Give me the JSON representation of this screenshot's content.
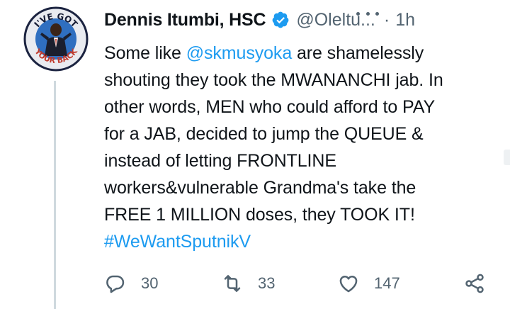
{
  "author": {
    "display_name": "Dennis Itumbi, HSC",
    "handle": "@Oleltu...",
    "time": "1h",
    "verified": true,
    "avatar_text_top": "I'VE GOT",
    "avatar_text_bottom": "YOUR BACK"
  },
  "header": {
    "separator": "·"
  },
  "tweet": {
    "lines": [
      [
        {
          "text": "Some like "
        },
        {
          "text": "@skmusyoka",
          "link": true
        },
        {
          "text": " are shamelessly"
        }
      ],
      [
        {
          "text": "shouting they took the MWANANCHI jab. In"
        }
      ],
      [
        {
          "text": "other words, MEN who could afford to PAY"
        }
      ],
      [
        {
          "text": "for a JAB, decided to jump the QUEUE &"
        }
      ],
      [
        {
          "text": "instead of letting FRONTLINE"
        }
      ],
      [
        {
          "text": "workers&vulnerable Grandma's take the"
        }
      ],
      [
        {
          "text": "FREE 1 MILLION doses, they TOOK IT!"
        }
      ],
      [
        {
          "text": "#WeWantSputnikV",
          "link": true
        }
      ]
    ]
  },
  "actions": {
    "reply_count": "30",
    "retweet_count": "33",
    "like_count": "147"
  },
  "icons": {
    "reply": "reply-icon",
    "retweet": "retweet-icon",
    "like": "heart-icon",
    "share": "share-icon",
    "more": "more-icon",
    "verified": "verified-badge-icon"
  },
  "colors": {
    "link": "#1d9bf0",
    "secondary_text": "#536471",
    "primary_text": "#0f1419",
    "verified": "#1d9bf0"
  }
}
